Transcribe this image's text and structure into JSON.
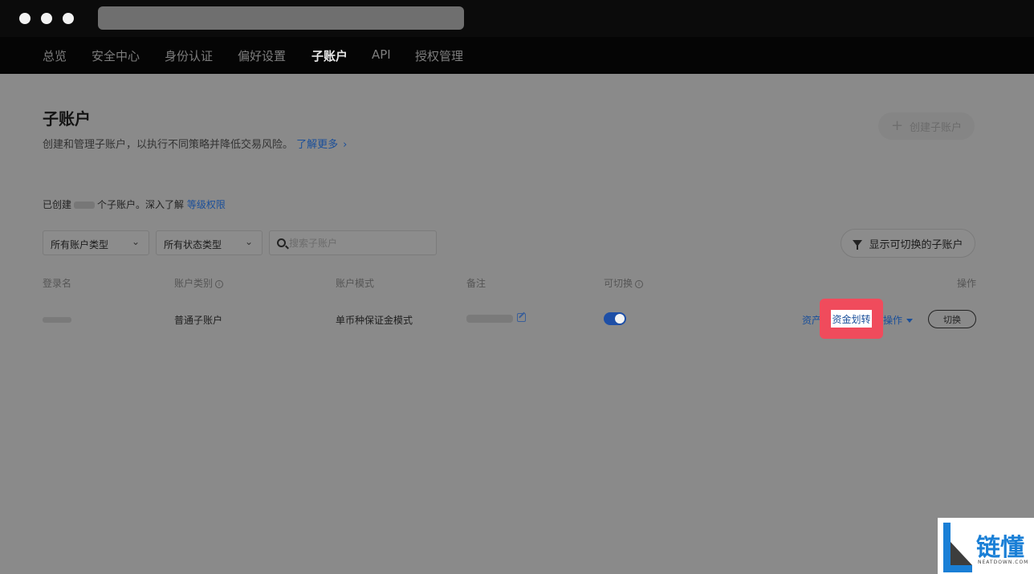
{
  "nav": {
    "items": [
      "总览",
      "安全中心",
      "身份认证",
      "偏好设置",
      "子账户",
      "API",
      "授权管理"
    ],
    "active_index": 4
  },
  "header": {
    "title": "子账户",
    "subtitle": "创建和管理子账户，以执行不同策略并降低交易风险。",
    "learn_more": "了解更多",
    "create_button": "创建子账户"
  },
  "summary": {
    "prefix": "已创建",
    "suffix": "个子账户。深入了解",
    "link": "等级权限"
  },
  "filters": {
    "account_type": "所有账户类型",
    "status_type": "所有状态类型",
    "search_placeholder": "搜索子账户",
    "show_switchable": "显示可切换的子账户"
  },
  "table": {
    "headers": [
      "登录名",
      "账户类别",
      "账户模式",
      "备注",
      "可切换",
      "操作"
    ],
    "rows": [
      {
        "account_type": "普通子账户",
        "account_mode": "单币种保证金模式",
        "switchable": true,
        "actions": {
          "assets": "资产",
          "transfer": "资金划转",
          "more": "操作",
          "switch": "切换"
        }
      }
    ]
  },
  "watermark": {
    "title": "链懂",
    "subtitle": "NEATDOWN.COM"
  },
  "colors": {
    "highlight": "#f04b5c",
    "link": "#1a4f9a",
    "toggle_on": "#1e4fa6",
    "brand": "#1a7fd6"
  }
}
